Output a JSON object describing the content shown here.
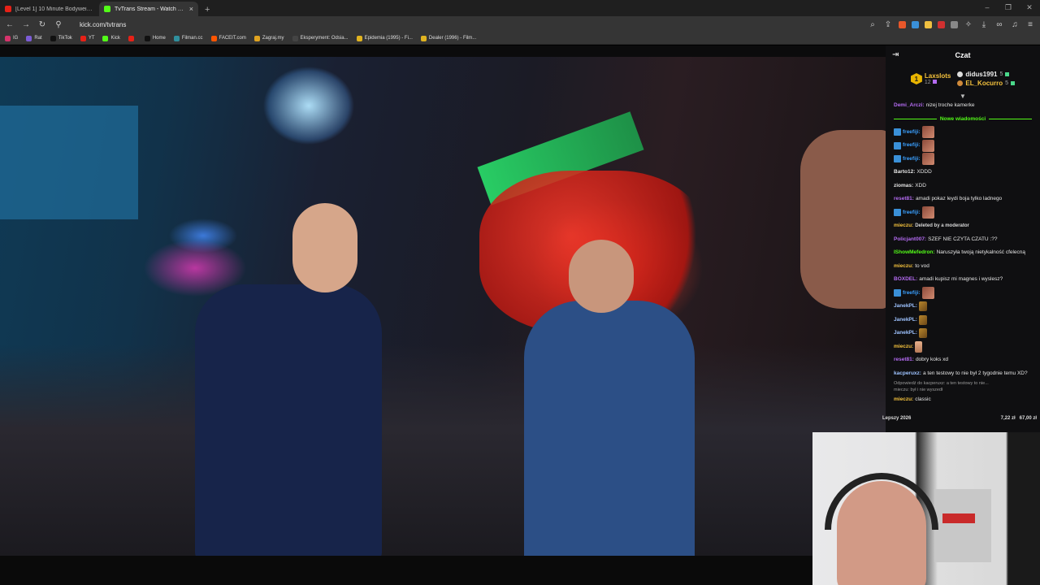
{
  "browser": {
    "tabs": [
      {
        "title": "[Level 1] 10 Minute Bodyweight Wo...",
        "favicon_color": "#e62117",
        "active": false
      },
      {
        "title": "TvTrans Stream - Watch Live o...",
        "favicon_color": "#53fc18",
        "active": true
      }
    ],
    "new_tab": "+",
    "url": "kick.com/tvtrans",
    "bookmarks": [
      {
        "label": "IG",
        "color": "#d6336c"
      },
      {
        "label": "Rat",
        "color": "#7c5cd6"
      },
      {
        "label": "TikTok",
        "color": "#111111"
      },
      {
        "label": "YT",
        "color": "#e62117"
      },
      {
        "label": "Kick",
        "color": "#53fc18"
      },
      {
        "label": "",
        "color": "#e62117"
      },
      {
        "label": "Home",
        "color": "#111111"
      },
      {
        "label": "Filman.cc",
        "color": "#2f8f9d"
      },
      {
        "label": "FACEIT.com",
        "color": "#ff5500"
      },
      {
        "label": "Zagraj.my",
        "color": "#e0a320"
      },
      {
        "label": "Eksperyment: Odsia...",
        "color": "#444444"
      },
      {
        "label": "Epidemia (1995) - Fi...",
        "color": "#e0b320"
      },
      {
        "label": "Dealer (1996) - Film...",
        "color": "#e0b320"
      }
    ]
  },
  "chat": {
    "title": "Czat",
    "leaderboard": {
      "first": {
        "rank": "1",
        "name": "Laxslots",
        "count": "12"
      },
      "others": [
        {
          "name": "didus1991",
          "count": "5"
        },
        {
          "name": "EL_Kocurro",
          "count": "5"
        }
      ]
    },
    "new_messages_label": "Nowe wiadomości",
    "messages": [
      {
        "user": "Demi_Arczi:",
        "color": "#b46bf2",
        "text": "nizej troche kamerke"
      },
      {
        "user": "freefiji:",
        "color": "#3aa0ff",
        "text": "",
        "emote": true
      },
      {
        "user": "freefiji:",
        "color": "#3aa0ff",
        "text": "",
        "emote": true
      },
      {
        "user": "freefiji:",
        "color": "#3aa0ff",
        "text": "",
        "emote": true
      },
      {
        "user": "Barto12:",
        "color": "#e4e4e4",
        "text": "XDDD"
      },
      {
        "user": "ziomas:",
        "color": "#e4e4e4",
        "text": "XDD"
      },
      {
        "user": "reset81:",
        "color": "#b46bf2",
        "text": "amadi pokaz leydi boja tylko ladnego"
      },
      {
        "user": "freefiji:",
        "color": "#3aa0ff",
        "text": "",
        "emote": true
      },
      {
        "user": "mieczu:",
        "color": "#f5c23d",
        "text": "Deleted by a moderator",
        "deleted": true
      },
      {
        "user": "Policjant007:",
        "color": "#b46bf2",
        "text": "SZEF NIE CZYTA CZATU :??"
      },
      {
        "user": "IShowMefedron:",
        "color": "#53fc18",
        "text": "Naruszyła twoją nietykalność cfelecną"
      },
      {
        "user": "mieczu:",
        "color": "#f5c23d",
        "text": "to vod"
      },
      {
        "user": "BOXDEL:",
        "color": "#b46bf2",
        "text": "amadi kupisz mi magnes i wyslesz?"
      },
      {
        "user": "freefiji:",
        "color": "#3aa0ff",
        "text": "",
        "emote": true
      },
      {
        "user": "JanekPL:",
        "color": "#9ec3ff",
        "text": "",
        "emote_small": true
      },
      {
        "user": "JanekPL:",
        "color": "#9ec3ff",
        "text": "",
        "emote_small": true
      },
      {
        "user": "JanekPL:",
        "color": "#9ec3ff",
        "text": "",
        "emote_small": true
      },
      {
        "user": "mieczu:",
        "color": "#f5c23d",
        "text": "",
        "emote_hand": true
      },
      {
        "user": "reset81:",
        "color": "#b46bf2",
        "text": "dobry koks xd"
      },
      {
        "user": "kacperuxz:",
        "color": "#9ec3ff",
        "text": "a ten testowy to nie był 2 tygodnie temu XD?"
      }
    ],
    "reply_preview": "Odpowiedź do kacperuxz: a ten testowy to nie...",
    "reply_text": "mieczu: był i nie wyszedł",
    "last_message": {
      "user": "mieczu:",
      "color": "#f5c23d",
      "text": "classic"
    },
    "goal": {
      "label": "Lepszy 2026",
      "current": "7,22 zł",
      "target": "67,00 zł"
    }
  }
}
